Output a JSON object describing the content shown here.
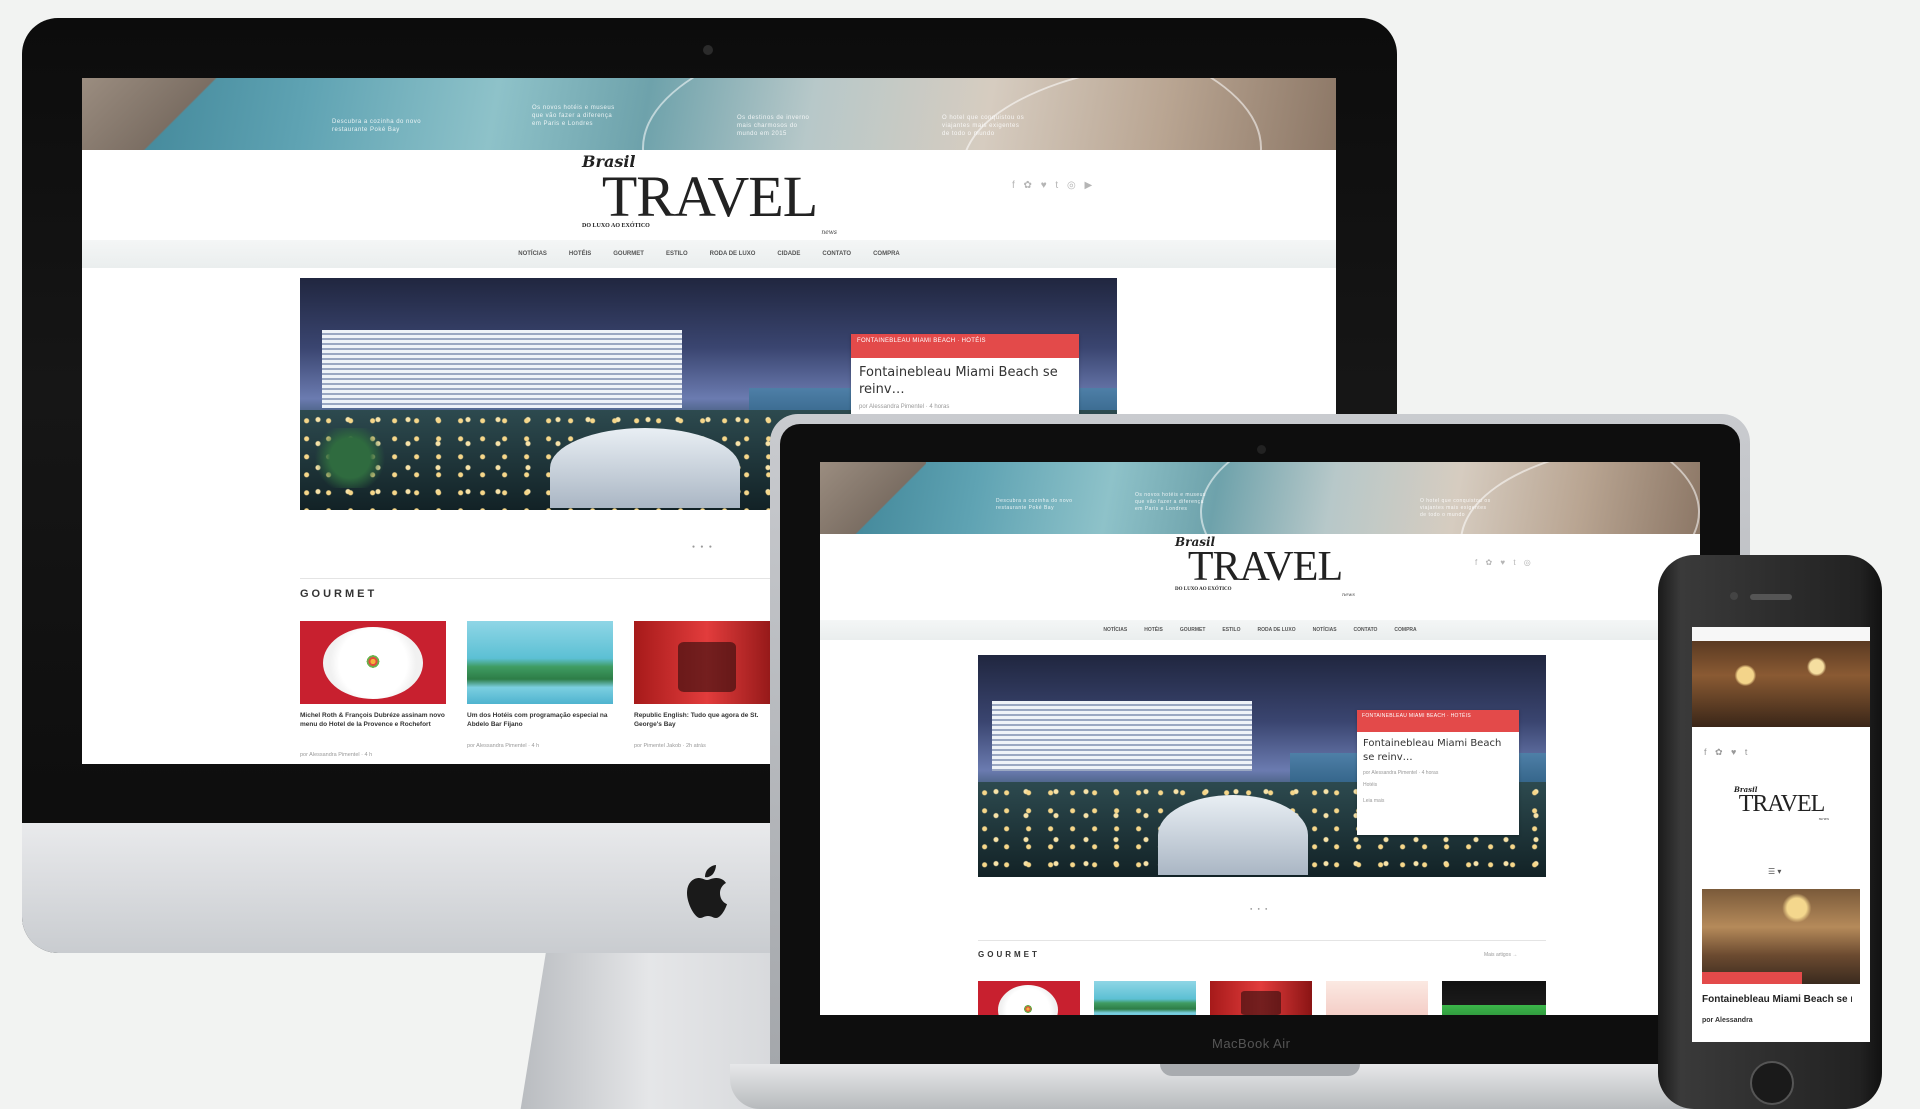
{
  "imac": {
    "site": {
      "banner_texts": [
        "Descubra a cozinha do novo\nrestaurante Poké Bay",
        "Os novos hotéis e museus\nque vão fazer a diferença\nem Paris e Londres",
        "Os destinos de inverno\nmais charmosos do\nmundo em 2015",
        "O hotel que conquistou os\nviajantes mais exigentes\nde todo o mundo"
      ],
      "logo": {
        "pre": "Brasil",
        "main": "TRAVEL",
        "sub": "DO LUXO AO EXÓTICO",
        "tiny": "news"
      },
      "social": "f ✿ ♥ t ◎ ▶",
      "nav": [
        "Notícias",
        "Hotéis",
        "Gourmet",
        "Estilo",
        "Roda de Luxo",
        "Cidade",
        "Contato",
        "Compra"
      ],
      "hero_card": {
        "tag": "Fontainebleau Miami Beach · Hotéis",
        "title": "Fontainebleau Miami Beach se reinv…",
        "meta": "por Alessandra Pimentel · 4 horas"
      },
      "dots": "● ● ●",
      "section": "Gourmet",
      "posts": [
        {
          "title": "Michel Roth & François Dubréze assinam novo menu do Hotel de la Provence e Rochefort",
          "meta": "por Alessandra Pimentel · 4 h"
        },
        {
          "title": "Um dos Hotéis com programação especial na Abdelo Bar Fijano",
          "meta": "por Alessandra Pimentel · 4 h"
        },
        {
          "title": "Republic English: Tudo que agora de St. George's Bay",
          "meta": "por Pimentel Jakob · 2h atrás"
        }
      ]
    }
  },
  "laptop": {
    "brand": "MacBook Air",
    "site": {
      "logo": {
        "pre": "Brasil",
        "main": "TRAVEL",
        "sub": "DO LUXO AO EXÓTICO",
        "tiny": "news"
      },
      "social": "f ✿ ♥ t ◎",
      "nav": [
        "Notícias",
        "Hotéis",
        "Gourmet",
        "Estilo",
        "Roda de Luxo",
        "Notícias",
        "Contato",
        "Compra"
      ],
      "hero_card": {
        "tag": "Fontainebleau Miami Beach · Hotéis",
        "title": "Fontainebleau Miami Beach se reinv…",
        "meta": "por Alessandra Pimentel · 4 horas",
        "extra": "Hotéis",
        "more": "Leia mais"
      },
      "dots": "● ● ●",
      "section": "Gourmet",
      "see_more": "Mais artigos →"
    }
  },
  "phone": {
    "social": "f ✿ ♥ t",
    "logo": {
      "pre": "Brasil",
      "main": "TRAVEL",
      "tiny": "news"
    },
    "menu": "☰ ▾",
    "post_title": "Fontainebleau Miami Beach se reinv…",
    "post_meta": "por Alessandra"
  }
}
